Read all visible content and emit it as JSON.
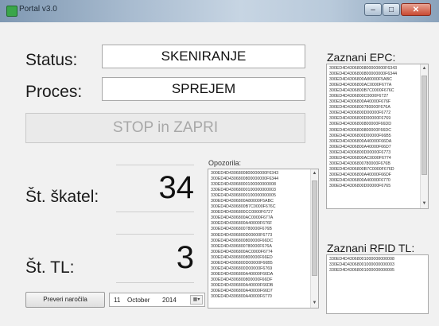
{
  "window": {
    "title": "Portal v3.0",
    "minimize_glyph": "–",
    "maximize_glyph": "□",
    "close_glyph": "✕"
  },
  "status": {
    "label": "Status:",
    "value": "SKENIRANJE"
  },
  "proces": {
    "label": "Proces:",
    "value": "SPREJEM"
  },
  "stop_button": {
    "label": "STOP in ZAPRI"
  },
  "counters": {
    "skatel_label": "Št. škatel:",
    "skatel_value": "34",
    "tl_label": "Št. TL:",
    "tl_value": "3"
  },
  "opozorila": {
    "label": "Opozorila:",
    "items": [
      "300ED4D4306800800000000F6343",
      "300ED4D4306800800000000F6344",
      "330ED4D43068000100000000008",
      "330ED4D43068000100000000003",
      "330ED4D43068000100000000005",
      "300ED4D4306800A80000F5ABC",
      "300ED4D4306800B7C0000F676C",
      "300ED4D4306800CC0000F6727",
      "300ED4D4306800AC0000F677A",
      "300ED4D4306800A40000F676F",
      "300ED4D4306800780000F676B",
      "300ED4D4306800D00000F6773",
      "300ED4D4306800800000F66DC",
      "300ED4D4306800780000F676A",
      "300ED4D4306800AC0000F6774",
      "300ED4D4306800800000F66ED",
      "300ED4D4306800D00000F66B5",
      "300ED4D4306800D00000F6769",
      "300ED4D4306800A40000F66DA",
      "300ED4D4306800800000F66DF",
      "300ED4D4306800A40000F66DB",
      "300ED4D4306800A40000F66D7",
      "300ED4D4306800A40000F6770"
    ]
  },
  "epc": {
    "label": "Zaznani EPC:",
    "items": [
      "300ED4D4306800800000000F6343",
      "300ED4D4306800800000000F6344",
      "300ED4D4306800A80000F5ABC",
      "300ED4D4306800AC0000F677A",
      "300ED4D4306800B7C0000F676C",
      "300ED4D4306800C0000F6727",
      "300ED4D4306800A40000F676F",
      "300ED4D4306800780000F676A",
      "300ED4D4306800D00000F6772",
      "300ED4D4306800D00000F6769",
      "300ED4D4306800800000F66DD",
      "300ED4D4306800800000F66DC",
      "300ED4D4306800D00000F66B5",
      "300ED4D4306800A40000F66DA",
      "300ED4D4306800A40000F66D7",
      "300ED4D4306800D00000F6773",
      "300ED4D4306800AC0000F6774",
      "300ED4D4306800780000F676B",
      "300ED4D4306800B7C0000F676D",
      "300ED4D4306800A40000F66DF",
      "300ED4D4306800A40000F6770",
      "300ED4D4306800D00000F6765"
    ]
  },
  "rfid": {
    "label": "Zaznani RFID TL:",
    "items": [
      "330ED4D43068001000000000008",
      "330ED4D43068001000000000003",
      "330ED4D43068001000000000005"
    ]
  },
  "footer": {
    "check_orders_button": "Preveri naročila",
    "date": {
      "day": "11",
      "month": "October",
      "year": "2014"
    }
  },
  "colors": {
    "background": "#f1f1f1",
    "titlebar": "#a9bcd0",
    "disabled_text": "#a8a8a8",
    "close_button": "#c94a33"
  }
}
